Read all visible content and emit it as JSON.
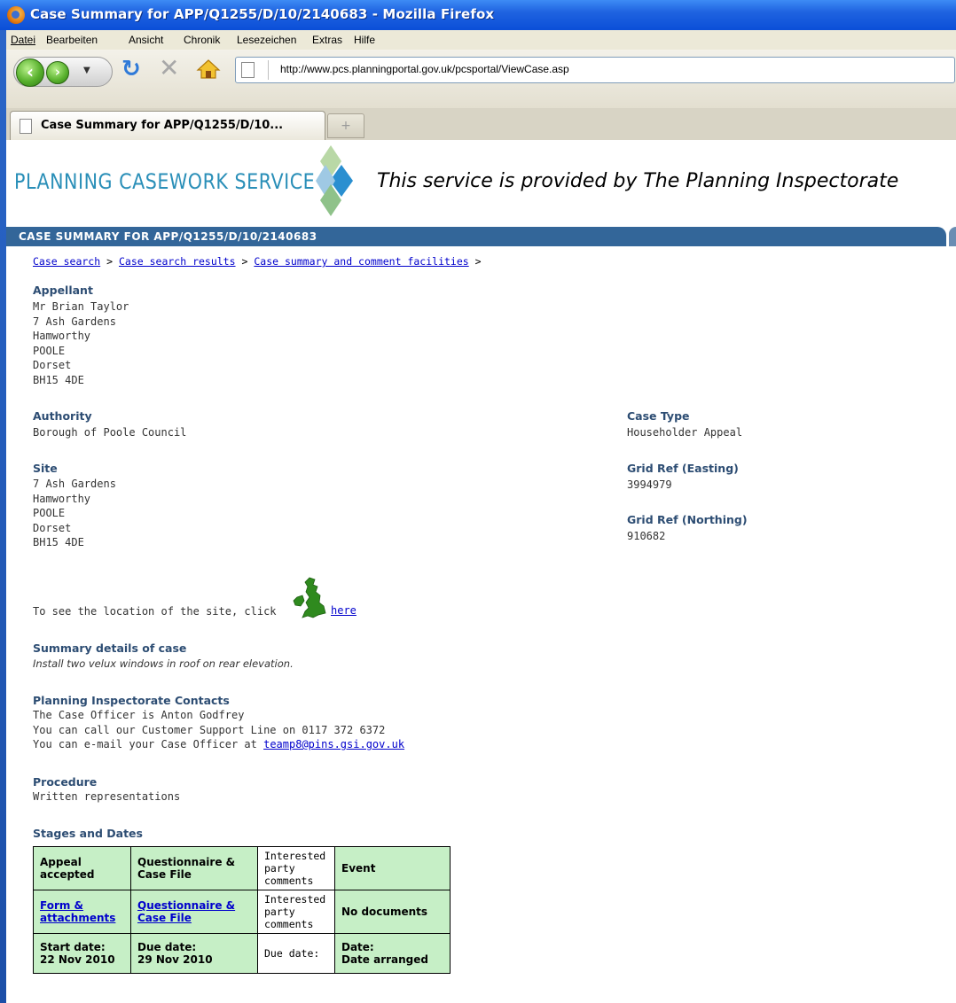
{
  "window": {
    "title": "Case Summary for APP/Q1255/D/10/2140683 - Mozilla Firefox"
  },
  "menu": [
    "Datei",
    "Bearbeiten",
    "Ansicht",
    "Chronik",
    "Lesezeichen",
    "Extras",
    "Hilfe"
  ],
  "toolbar": {
    "url": "http://www.pcs.planningportal.gov.uk/pcsportal/ViewCase.asp"
  },
  "tab": {
    "title": "Case Summary for APP/Q1255/D/10...",
    "newtab": "+"
  },
  "header": {
    "logo": "PLANNING CASEWORK SERVICE",
    "tagline": "This service is provided by The Planning Inspectorate",
    "case_bar": "CASE SUMMARY FOR APP/Q1255/D/10/2140683"
  },
  "breadcrumb": {
    "items": [
      "Case search",
      "Case search results",
      "Case summary and comment facilities"
    ],
    "sep": ">"
  },
  "appellant": {
    "label": "Appellant",
    "lines": [
      "Mr Brian Taylor",
      "7 Ash Gardens",
      "Hamworthy",
      "POOLE",
      "Dorset",
      "BH15 4DE"
    ]
  },
  "authority": {
    "label": "Authority",
    "value": "Borough of Poole Council"
  },
  "site": {
    "label": "Site",
    "lines": [
      "7 Ash Gardens",
      "Hamworthy",
      "POOLE",
      "Dorset",
      "BH15 4DE"
    ]
  },
  "case_type": {
    "label": "Case Type",
    "value": "Householder Appeal"
  },
  "grid_easting": {
    "label": "Grid Ref (Easting)",
    "value": "3994979"
  },
  "grid_northing": {
    "label": "Grid Ref (Northing)",
    "value": "910682"
  },
  "location": {
    "text": "To see the location of the site, click",
    "link": "here"
  },
  "summary": {
    "label": "Summary details of case",
    "value": "Install two velux windows in roof on rear elevation."
  },
  "contacts": {
    "label": "Planning Inspectorate Contacts",
    "line1": "The Case Officer is Anton Godfrey",
    "line2": "You can call our Customer Support Line on 0117 372 6372",
    "line3_prefix": "You can e-mail your Case Officer at",
    "email": "teamp8@pins.gsi.gov.uk"
  },
  "procedure": {
    "label": "Procedure",
    "value": "Written representations"
  },
  "stages": {
    "label": "Stages and Dates",
    "headers": [
      "Appeal accepted",
      "Questionnaire & Case File",
      "Interested party comments",
      "Event"
    ],
    "docs": [
      "Form & attachments",
      "Questionnaire & Case File",
      "Interested party comments",
      "No documents"
    ],
    "dates": [
      {
        "label": "Start date:",
        "value": "22 Nov 2010"
      },
      {
        "label": "Due date:",
        "value": "29 Nov 2010"
      },
      {
        "label": "Due date:",
        "value": ""
      },
      {
        "label": "Date:",
        "value": "Date arranged"
      }
    ]
  },
  "colors": {
    "titlebar": "#0b4fd8",
    "case_bar": "#336699",
    "label": "#2d4d73",
    "table_green": "#c6efc6",
    "link": "#0000cc"
  }
}
